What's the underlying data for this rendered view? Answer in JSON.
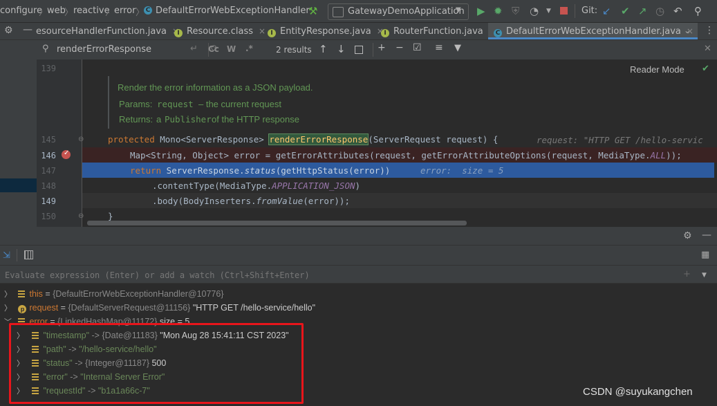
{
  "navbar": {
    "crumbs": [
      "configure",
      "web",
      "reactive",
      "error",
      "DefaultErrorWebExceptionHandler"
    ],
    "run_config": "GatewayDemoApplication",
    "git_label": "Git:"
  },
  "tabs": [
    {
      "label": "esourceHandlerFunction.java",
      "icon": "I",
      "active": false
    },
    {
      "label": "Resource.class",
      "icon": "I",
      "active": false
    },
    {
      "label": "EntityResponse.java",
      "icon": "I",
      "active": false
    },
    {
      "label": "RouterFunction.java",
      "icon": "I",
      "active": false
    },
    {
      "label": "DefaultErrorWebExceptionHandler.java",
      "icon": "C",
      "active": true
    }
  ],
  "search": {
    "query": "renderErrorResponse",
    "result_count": "2 results",
    "cc": "Cc",
    "w": "W",
    "regex": ".*"
  },
  "editor": {
    "reader_mode": "Reader Mode",
    "line_numbers": [
      "139",
      "145",
      "146",
      "147",
      "148",
      "149",
      "150"
    ],
    "doc": {
      "summary": "Render the error information as a JSON payload.",
      "params_label": "Params:",
      "params_name": "request",
      "params_desc": "– the current request",
      "returns_label": "Returns:",
      "returns_pre": "a",
      "returns_code": "Publisher",
      "returns_post": "of the HTTP response"
    },
    "lines": {
      "l145_kw": "protected",
      "l145_type": " Mono<ServerResponse> ",
      "l145_fn": "renderErrorResponse",
      "l145_rest": "(ServerRequest request) {",
      "l145_hint": "request: \"HTTP GET /hello-servic",
      "l146_pre": "Map<String, Object> error = getErrorAttributes(request, getErrorAttributeOptions(request, MediaType.",
      "l146_const": "ALL",
      "l146_post": "));",
      "l147_kw": "return",
      "l147_pre": " ServerResponse.",
      "l147_it": "status",
      "l147_post": "(getHttpStatus(error))",
      "l147_hint": "error:  size = 5",
      "l148_pre": ".contentType(MediaType.",
      "l148_const": "APPLICATION_JSON",
      "l148_post": ")",
      "l149_pre": ".body(BodyInserters.",
      "l149_it": "fromValue",
      "l149_post": "(error));",
      "l150": "}"
    }
  },
  "debug": {
    "watch_placeholder": "Evaluate expression (Enter) or add a watch (Ctrl+Shift+Enter)",
    "vars": [
      {
        "name": "this",
        "eq": " = ",
        "value": "{DefaultErrorWebExceptionHandler@10776}",
        "extra": ""
      },
      {
        "name": "request",
        "eq": " = ",
        "value": "{DefaultServerRequest@11156}",
        "extra": " \"HTTP GET /hello-service/hello\""
      },
      {
        "name": "error",
        "eq": " = ",
        "value": "{LinkedHashMap@11172}",
        "extra": "  size = 5"
      }
    ],
    "entries": [
      {
        "key": "\"timestamp\"",
        "arrow": " -> ",
        "value": "{Date@11183}",
        "extra": " \"Mon Aug 28 15:41:11 CST 2023\""
      },
      {
        "key": "\"path\"",
        "arrow": " -> ",
        "value": "\"/hello-service/hello\"",
        "extra": ""
      },
      {
        "key": "\"status\"",
        "arrow": " -> ",
        "value": "{Integer@11187}",
        "extra": " 500"
      },
      {
        "key": "\"error\"",
        "arrow": " -> ",
        "value": "\"Internal Server Error\"",
        "extra": ""
      },
      {
        "key": "\"requestId\"",
        "arrow": " -> ",
        "value": "\"b1a1a66c-7\"",
        "extra": ""
      }
    ]
  },
  "watermark": "CSDN @suyukangchen",
  "colors": {
    "highlight_box": "#e8151b",
    "exec_line": "#2d5a9e",
    "breakpoint": "#c75450"
  }
}
